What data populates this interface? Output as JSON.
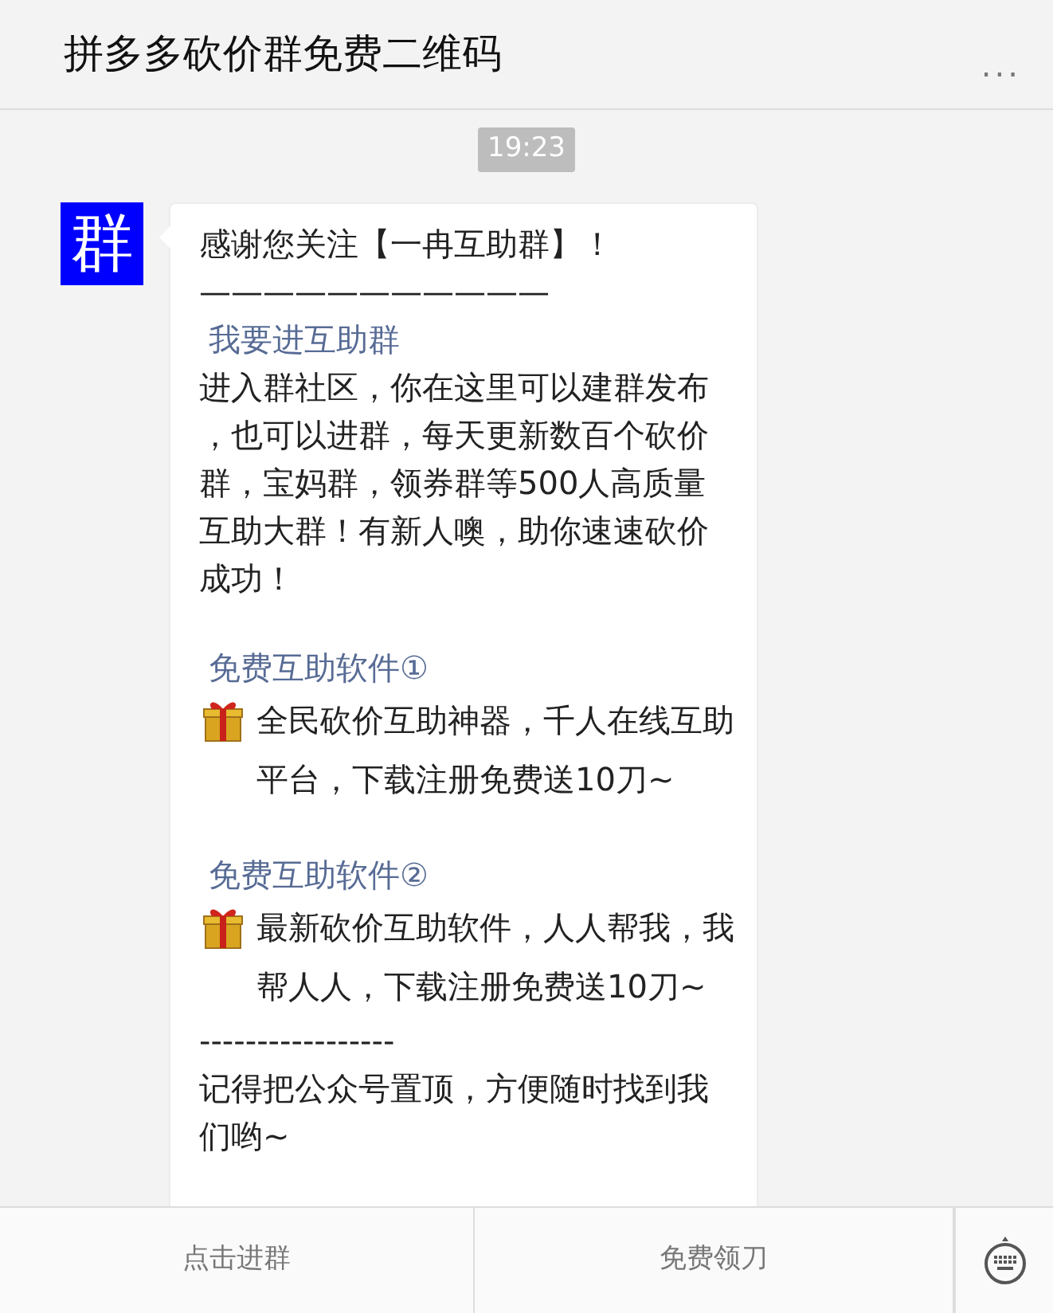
{
  "header": {
    "title": "拼多多砍价群免费二维码",
    "more": "..."
  },
  "timestamp": "19:23",
  "message": {
    "avatar": "群",
    "blocks": [
      {
        "kind": "text",
        "text": "感谢您关注【一冉互助群】！"
      },
      {
        "kind": "text",
        "text": "———————————"
      },
      {
        "kind": "link",
        "text": "我要进互助群"
      },
      {
        "kind": "text",
        "text": "进入群社区，你在这里可以建群发布，也可以进群，每天更新数百个砍价群，宝妈群，领券群等500人高质量互助大群！有新人噢，助你速速砍价成功！"
      },
      {
        "kind": "link",
        "text": "免费互助软件①"
      },
      {
        "kind": "gift",
        "text": "全民砍价互助神器，千人在线互助平台，下载注册免费送10刀~"
      },
      {
        "kind": "link",
        "text": "免费互助软件②"
      },
      {
        "kind": "gift",
        "text": "最新砍价互助软件，人人帮我，我帮人人，下载注册免费送10刀~"
      },
      {
        "kind": "text",
        "text": "-----------------"
      },
      {
        "kind": "text",
        "text": "记得把公众号置顶，方便随时找到我们哟~"
      }
    ]
  },
  "menu": [
    {
      "label": "点击进群"
    },
    {
      "label": "免费领刀"
    }
  ]
}
